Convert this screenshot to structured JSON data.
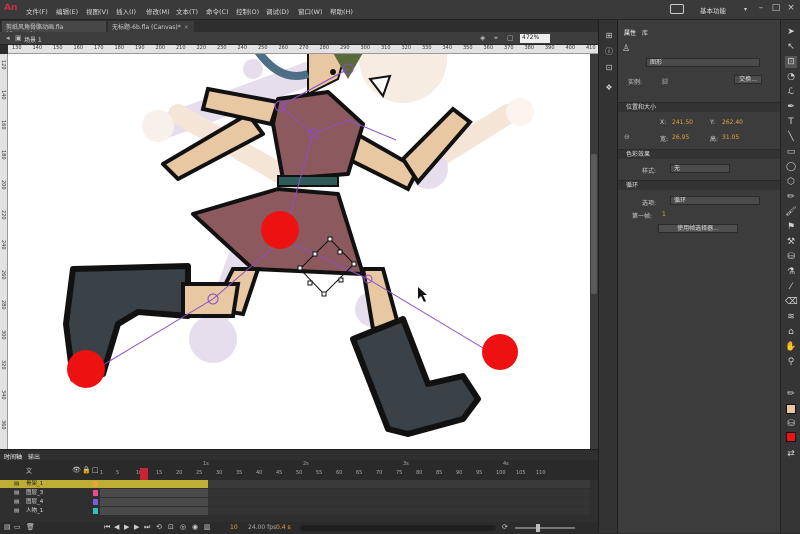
{
  "app": {
    "logo": "An",
    "workspace": "基本功能"
  },
  "menu": [
    "文件(F)",
    "编辑(E)",
    "视图(V)",
    "插入(I)",
    "修改(M)",
    "文本(T)",
    "命令(C)",
    "控制(O)",
    "调试(D)",
    "窗口(W)",
    "帮助(H)"
  ],
  "window_controls": [
    "–",
    "□",
    "×"
  ],
  "doc_tabs": [
    {
      "label": "剪纸风角骨骼动画.fla (Canvas)*",
      "active": true
    },
    {
      "label": "无标题-6b.fla (Canvas)*",
      "active": false
    }
  ],
  "editbar": {
    "scene": "场景 1",
    "zoom": "472%"
  },
  "ruler": [
    "130",
    "140",
    "150",
    "160",
    "170",
    "180",
    "190",
    "200",
    "210",
    "220",
    "230",
    "240",
    "250",
    "260",
    "270",
    "280",
    "290",
    "300",
    "310",
    "320",
    "330",
    "340",
    "350",
    "360",
    "370",
    "380",
    "390",
    "400",
    "410"
  ],
  "vruler": [
    "120",
    "140",
    "160",
    "180",
    "200",
    "220",
    "240",
    "260",
    "280",
    "300",
    "320",
    "340",
    "360"
  ],
  "timeline": {
    "tabs": [
      "时间轴",
      "输出"
    ],
    "layer_header": "文",
    "ruler_ticks": [
      "1",
      "5",
      "10",
      "15",
      "20",
      "25",
      "30",
      "35",
      "40",
      "45",
      "50",
      "55",
      "60",
      "65",
      "70",
      "75",
      "80",
      "85",
      "90",
      "95",
      "100",
      "105",
      "110"
    ],
    "seconds": [
      "1s",
      "2s",
      "3s",
      "4s"
    ],
    "layers": [
      {
        "name": "骨架_1",
        "selected": true
      },
      {
        "name": "图层_3",
        "selected": false
      },
      {
        "name": "图层_4",
        "selected": false
      },
      {
        "name": "人物_1",
        "selected": false
      }
    ],
    "current_frame": "10",
    "fps": "24.00 fps",
    "elapsed": "0.4 s"
  },
  "properties": {
    "tabs": [
      "属性",
      "库"
    ],
    "symbol_type": "图形",
    "instance_label": "实例:",
    "instance_value": "脚",
    "swap_button": "交换...",
    "section_position": "位置和大小",
    "x_label": "X:",
    "x_value": "241.50",
    "y_label": "Y:",
    "y_value": "262.40",
    "w_label": "宽:",
    "w_value": "26.95",
    "h_label": "高:",
    "h_value": "31.05",
    "section_color": "色彩效果",
    "style_label": "样式:",
    "style_value": "无",
    "section_loop": "循环",
    "option_label": "选项:",
    "option_value": "循环",
    "first_label": "第一帧:",
    "first_value": "1",
    "frame_picker_button": "使用帧选择器..."
  },
  "colors": {
    "accent_select": "#bfae34",
    "stroke": "#000000",
    "fill": "#e53935",
    "value_text": "#e8a33c"
  }
}
